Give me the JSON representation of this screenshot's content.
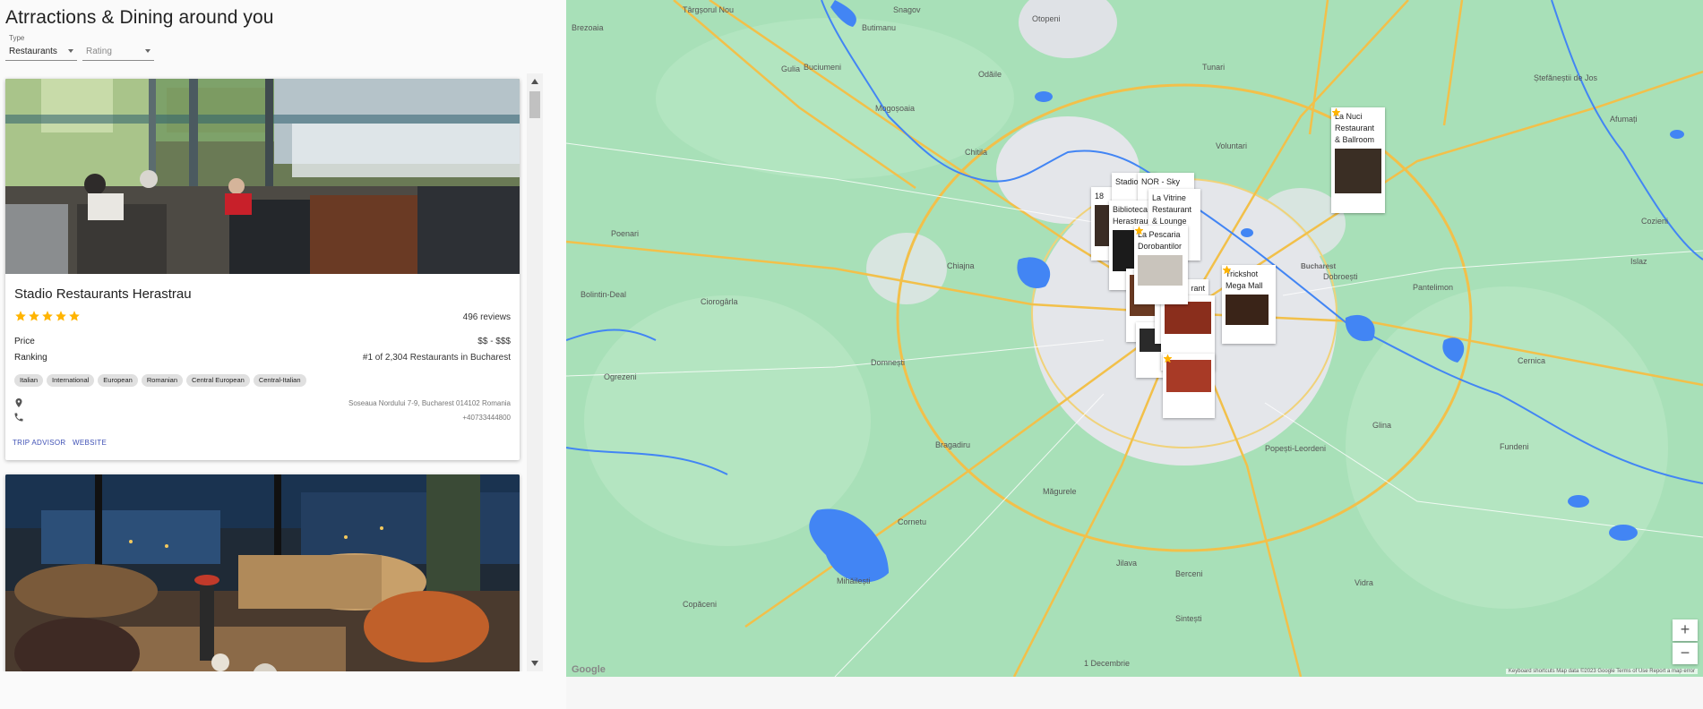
{
  "header": {
    "title": "Atrractions & Dining around you"
  },
  "filters": {
    "type": {
      "label": "Type",
      "value": "Restaurants"
    },
    "rating": {
      "placeholder": "Rating"
    }
  },
  "cards": [
    {
      "name": "Stadio Restaurants Herastrau",
      "rating": 5,
      "reviews": "496 reviews",
      "price_label": "Price",
      "price": "$$ - $$$",
      "ranking_label": "Ranking",
      "ranking": "#1 of 2,304 Restaurants in Bucharest",
      "tags": [
        "Italian",
        "International",
        "European",
        "Romanian",
        "Central European",
        "Central-Italian"
      ],
      "address": "Soseaua Nordului 7-9, Bucharest 014102 Romania",
      "phone": "+40733444800",
      "links": [
        "TRIP ADVISOR",
        "WEBSITE"
      ]
    },
    {
      "name": "",
      "rating": 0
    }
  ],
  "map": {
    "places": [
      "Târgșorul Nou",
      "Snagov",
      "Otopeni",
      "Brezoaia",
      "Butimanu",
      "Buciumeni",
      "Gulia",
      "Odăile",
      "Tunari",
      "Ștefăneștii de Jos",
      "Afumați",
      "Mogoșoaia",
      "Voluntari",
      "Cozieni",
      "Poenari",
      "Chitila",
      "Bucharest",
      "Chiajna",
      "Dobroești",
      "Pantelimon",
      "Islaz",
      "Bolintin-Deal",
      "Ciorogârla",
      "Domnești",
      "Cernica",
      "Ogrezeni",
      "Bragadiru",
      "Măgurele",
      "Popești-Leordeni",
      "Glina",
      "Fundeni",
      "Cornetu",
      "Jilava",
      "Berceni",
      "Sintești",
      "Vidra",
      "Mihăilești",
      "Copăceni",
      "1 Decembrie"
    ],
    "markers": [
      {
        "name": "La Nuci Restaurant & Ballroom"
      },
      {
        "name": "Stadio"
      },
      {
        "name": "NOR - Sky"
      },
      {
        "name": "18"
      },
      {
        "name": "Biblioteca Herastrau"
      },
      {
        "name": "La Vitrine Restaurant & Lounge"
      },
      {
        "name": "La Pescaria Dorobantilor"
      },
      {
        "name": "Trickshot Mega Mall"
      },
      {
        "name": "rant"
      }
    ],
    "attribution": "Keyboard shortcuts   Map data ©2023 Google   Terms of Use   Report a map error",
    "logo": "Google",
    "zoom_in": "+",
    "zoom_out": "−"
  },
  "colors": {
    "star": "#ffb400",
    "link": "#3f51b5",
    "map_green": "#a8e0b8",
    "map_water": "#4285f4",
    "road": "#f2c04a"
  }
}
